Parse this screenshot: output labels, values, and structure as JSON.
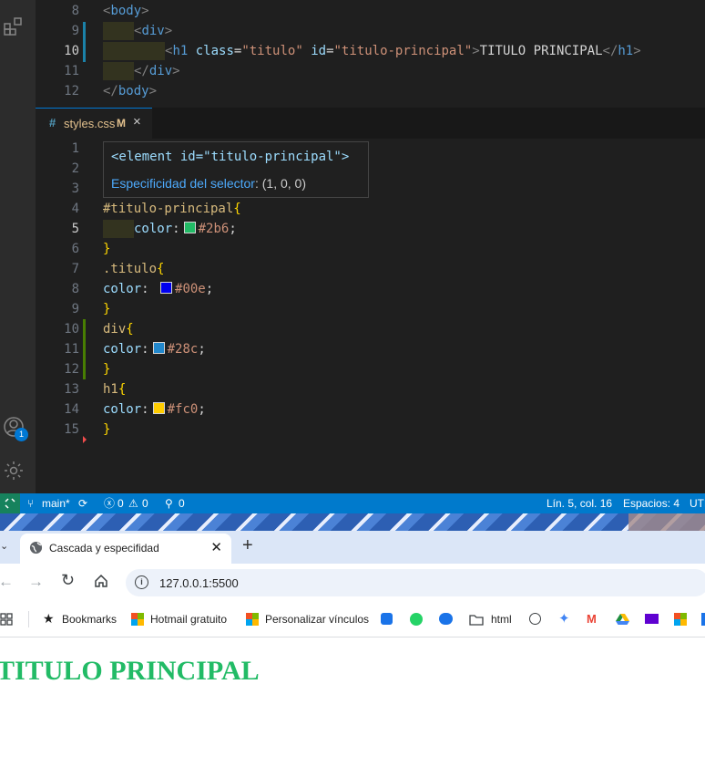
{
  "html_editor": {
    "lines": [
      {
        "n": "8",
        "indent": 0,
        "tokens": [
          [
            "t-br",
            "<"
          ],
          [
            "t-tag",
            "body"
          ],
          [
            "t-br",
            ">"
          ]
        ]
      },
      {
        "n": "9",
        "indent": 1,
        "tokens": [
          [
            "t-br",
            "<"
          ],
          [
            "t-tag",
            "div"
          ],
          [
            "t-br",
            ">"
          ]
        ]
      },
      {
        "n": "10",
        "indent": 2,
        "active": true,
        "tokens": [
          [
            "t-br",
            "<"
          ],
          [
            "t-tag",
            "h1"
          ],
          [
            "t-txt",
            " "
          ],
          [
            "t-attr",
            "class"
          ],
          [
            "t-txt",
            "="
          ],
          [
            "t-str",
            "\"titulo\""
          ],
          [
            "t-txt",
            " "
          ],
          [
            "t-attr",
            "id"
          ],
          [
            "t-txt",
            "="
          ],
          [
            "t-str",
            "\"titulo-principal\""
          ],
          [
            "t-br",
            ">"
          ],
          [
            "t-txt",
            "TITULO PRINCIPAL"
          ],
          [
            "t-br",
            "</"
          ],
          [
            "t-tag",
            "h1"
          ],
          [
            "t-br",
            ">"
          ]
        ]
      },
      {
        "n": "11",
        "indent": 1,
        "tokens": [
          [
            "t-br",
            "</"
          ],
          [
            "t-tag",
            "div"
          ],
          [
            "t-br",
            ">"
          ]
        ]
      },
      {
        "n": "12",
        "indent": 0,
        "tokens": [
          [
            "t-br",
            "</"
          ],
          [
            "t-tag",
            "body"
          ],
          [
            "t-br",
            ">"
          ]
        ]
      }
    ]
  },
  "css_tab": {
    "icon": "#",
    "name": "styles.css",
    "modified": "M",
    "close": "×"
  },
  "hover": {
    "element_line": "<element id=\"titulo-principal\">",
    "specificity_label": "Especificidad del selector",
    "specificity_value": ": (1, 0, 0)"
  },
  "css_editor": {
    "lines": [
      {
        "n": "1",
        "tokens": []
      },
      {
        "n": "2",
        "tokens": []
      },
      {
        "n": "3",
        "tokens": []
      },
      {
        "n": "4",
        "tokens": [
          [
            "c-sel",
            "#titulo-principal"
          ],
          [
            "c-brace",
            "{"
          ]
        ]
      },
      {
        "n": "5",
        "active": true,
        "indent": 1,
        "tokens": [
          [
            "c-prop",
            "color"
          ],
          [
            "c-punc",
            ":"
          ],
          [
            "swatch",
            "#22bb66"
          ],
          [
            "c-val",
            "#2b6"
          ],
          [
            "c-punc",
            ";"
          ]
        ]
      },
      {
        "n": "6",
        "tokens": [
          [
            "c-brace",
            "}"
          ]
        ]
      },
      {
        "n": "7",
        "tokens": [
          [
            "c-sel",
            ".titulo"
          ],
          [
            "c-brace",
            "{"
          ]
        ]
      },
      {
        "n": "8",
        "tokens": [
          [
            "c-prop",
            "color"
          ],
          [
            "c-punc",
            ": "
          ],
          [
            "swatch",
            "#0000ee"
          ],
          [
            "c-val",
            "#00e"
          ],
          [
            "c-punc",
            ";"
          ]
        ]
      },
      {
        "n": "9",
        "tokens": [
          [
            "c-brace",
            "}"
          ]
        ]
      },
      {
        "n": "10",
        "tokens": [
          [
            "c-sel",
            "div"
          ],
          [
            "c-brace",
            "{"
          ]
        ]
      },
      {
        "n": "11",
        "tokens": [
          [
            "c-prop",
            "color"
          ],
          [
            "c-punc",
            ":"
          ],
          [
            "swatch",
            "#2288cc"
          ],
          [
            "c-val",
            "#28c"
          ],
          [
            "c-punc",
            ";"
          ]
        ]
      },
      {
        "n": "12",
        "tokens": [
          [
            "c-brace",
            "}"
          ]
        ]
      },
      {
        "n": "13",
        "tokens": [
          [
            "c-sel",
            "h1"
          ],
          [
            "c-brace",
            "{"
          ]
        ]
      },
      {
        "n": "14",
        "tokens": [
          [
            "c-prop",
            "color"
          ],
          [
            "c-punc",
            ":"
          ],
          [
            "swatch",
            "#ffcc00"
          ],
          [
            "c-val",
            "#fc0"
          ],
          [
            "c-punc",
            ";"
          ]
        ]
      },
      {
        "n": "15",
        "tokens": [
          [
            "c-brace",
            "}"
          ]
        ]
      }
    ]
  },
  "statusbar": {
    "branch": "main*",
    "errors": "0",
    "warnings": "0",
    "ports": "0",
    "position": "Lín. 5, col. 16",
    "spaces": "Espacios: 4",
    "encoding": "UTF"
  },
  "accounts_badge": "1",
  "browser": {
    "tab_title": "Cascada y especifidad",
    "url": "127.0.0.1:5500",
    "bookmarks": [
      "Bookmarks",
      "Hotmail gratuito",
      "Personalizar vínculos",
      "html"
    ],
    "page_heading": "TITULO PRINCIPAL",
    "heading_color": "#22bb66"
  },
  "colors": {
    "editor_bg": "#1f1f1f",
    "status_blue": "#007acc",
    "remote_green": "#16825d"
  }
}
